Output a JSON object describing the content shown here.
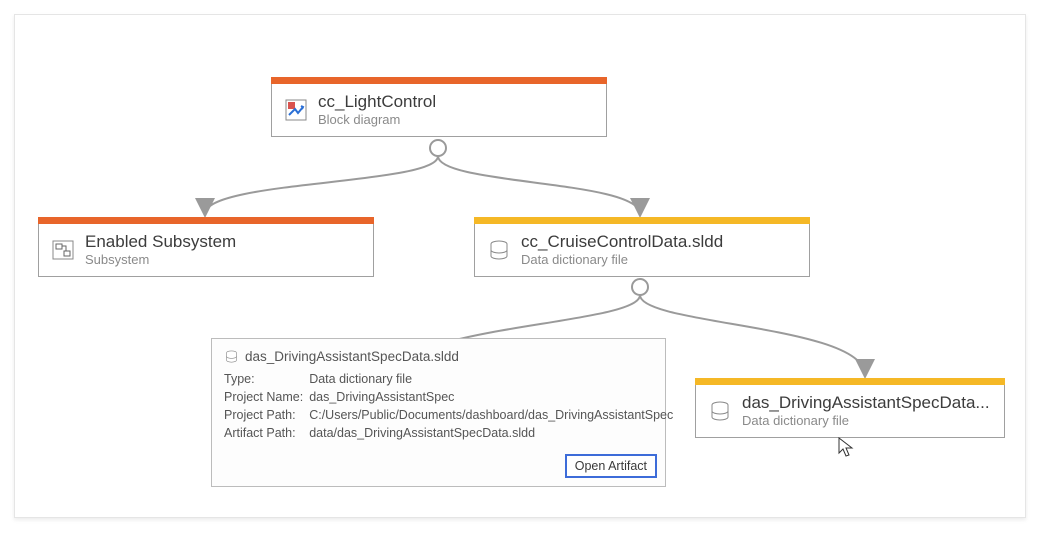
{
  "nodes": {
    "root": {
      "title": "cc_LightControl",
      "sub": "Block diagram"
    },
    "left": {
      "title": "Enabled Subsystem",
      "sub": "Subsystem"
    },
    "mid": {
      "title": "cc_CruiseControlData.sldd",
      "sub": "Data dictionary file"
    },
    "child": {
      "title": "das_DrivingAssistantSpecData...",
      "sub": "Data dictionary file"
    }
  },
  "tooltip": {
    "header": "das_DrivingAssistantSpecData.sldd",
    "rows": {
      "type_k": "Type:",
      "type_v": "Data dictionary file",
      "proj_k": "Project Name:",
      "proj_v": "das_DrivingAssistantSpec",
      "path_k": "Project Path:",
      "path_v": "C:/Users/Public/Documents/dashboard/das_DrivingAssistantSpec",
      "art_k": "Artifact Path:",
      "art_v": "data/das_DrivingAssistantSpecData.sldd"
    },
    "button": "Open Artifact"
  }
}
